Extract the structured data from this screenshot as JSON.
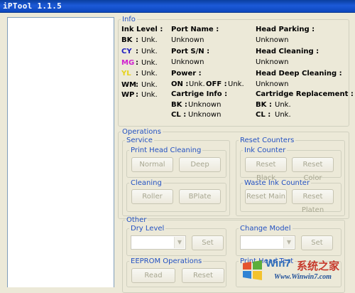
{
  "window": {
    "title": "iPTool 1.1.5"
  },
  "info": {
    "legend": "Info",
    "ink_level_label": "Ink Level :",
    "inks": [
      {
        "name": "BK",
        "color": "#000000",
        "value": "Unk."
      },
      {
        "name": "CY",
        "color": "#2020c0",
        "value": "Unk."
      },
      {
        "name": "MG",
        "color": "#d020d0",
        "value": "Unk."
      },
      {
        "name": "YL",
        "color": "#e6d21a",
        "value": "Unk."
      },
      {
        "name": "WM",
        "color": "#000000",
        "value": "Unk."
      },
      {
        "name": "WP",
        "color": "#000000",
        "value": "Unk."
      }
    ],
    "port_name_label": "Port Name :",
    "port_name_value": "Unknown",
    "port_sn_label": "Port S/N :",
    "port_sn_value": "Unknown",
    "power_label": "Power :",
    "on_label": "ON :",
    "on_value": "Unk.",
    "off_label": "OFF :",
    "off_value": "Unk.",
    "cartridge_info_label": "Cartrige Info :",
    "cart_bk_label": "BK :",
    "cart_bk_value": "Unknown",
    "cart_cl_label": "CL :",
    "cart_cl_value": "Unknown",
    "head_parking_label": "Head Parking :",
    "head_parking_value": "Unknown",
    "head_cleaning_label": "Head Cleaning :",
    "head_cleaning_value": "Unknown",
    "head_deep_cleaning_label": "Head Deep Cleaning :",
    "head_deep_cleaning_value": "Unknown",
    "cartridge_replacement_label": "Cartridge Replacement :",
    "repl_bk_label": "BK :",
    "repl_bk_value": "Unk.",
    "repl_cl_label": "CL :",
    "repl_cl_value": "Unk."
  },
  "operations": {
    "legend": "Operations",
    "service": {
      "legend": "Service",
      "print_head_cleaning": {
        "legend": "Print Head Cleaning",
        "normal": "Normal",
        "deep": "Deep"
      },
      "cleaning": {
        "legend": "Cleaning",
        "roller": "Roller",
        "bplate": "BPlate"
      }
    },
    "reset_counters": {
      "legend": "Reset Counters",
      "ink_counter": {
        "legend": "Ink Counter",
        "reset_black": "Reset Black",
        "reset_color": "Reset Color"
      },
      "waste_ink_counter": {
        "legend": "Waste Ink Counter",
        "reset_main": "Reset Main",
        "reset_platen": "Reset Platen"
      }
    }
  },
  "other": {
    "legend": "Other",
    "dry_level": {
      "legend": "Dry Level",
      "set": "Set"
    },
    "change_model": {
      "legend": "Change Model",
      "set": "Set"
    },
    "eeprom": {
      "legend": "EEPROM Operations",
      "read": "Read",
      "reset": "Reset"
    },
    "print_head_test": {
      "legend": "Print Head Test"
    }
  },
  "watermark": {
    "logo_text": "Win7",
    "logo_cn": "系统之家",
    "url": "Www.Winwin7.com"
  }
}
